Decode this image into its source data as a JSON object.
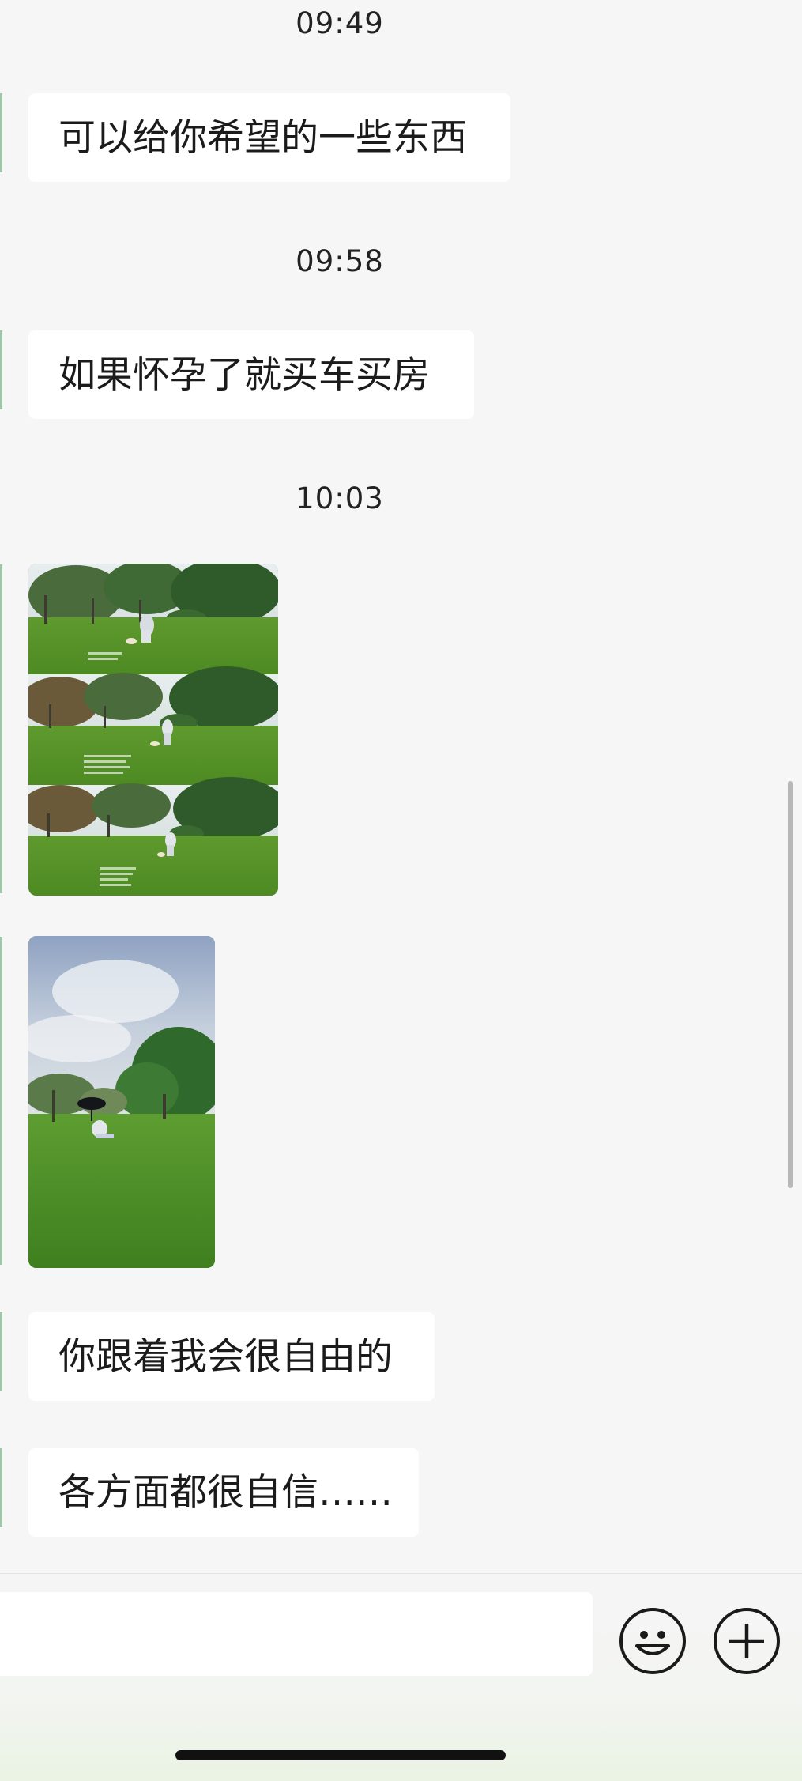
{
  "chat": {
    "items": [
      {
        "type": "time",
        "text": "09:49"
      },
      {
        "type": "text",
        "text": "可以给你希望的一些东西"
      },
      {
        "type": "time",
        "text": "09:58"
      },
      {
        "type": "text",
        "text": "如果怀孕了就买车买房"
      },
      {
        "type": "time",
        "text": "10:03"
      },
      {
        "type": "image",
        "content": "three stacked park photos, person bending over on lawn with small dog, with overlaid caption text"
      },
      {
        "type": "image",
        "content": "person sitting on green lawn under black umbrella, trees and cloudy sky"
      },
      {
        "type": "text",
        "text": "你跟着我会很自由的"
      },
      {
        "type": "text",
        "text": "各方面都很自信……"
      }
    ]
  },
  "input_bar": {
    "emoji_icon": "emoji-smile-icon",
    "plus_icon": "plus-circle-icon"
  },
  "colors": {
    "background": "#f6f6f6",
    "bubble": "#ffffff",
    "text": "#1b1b1b",
    "grass": "#5e9e34"
  }
}
